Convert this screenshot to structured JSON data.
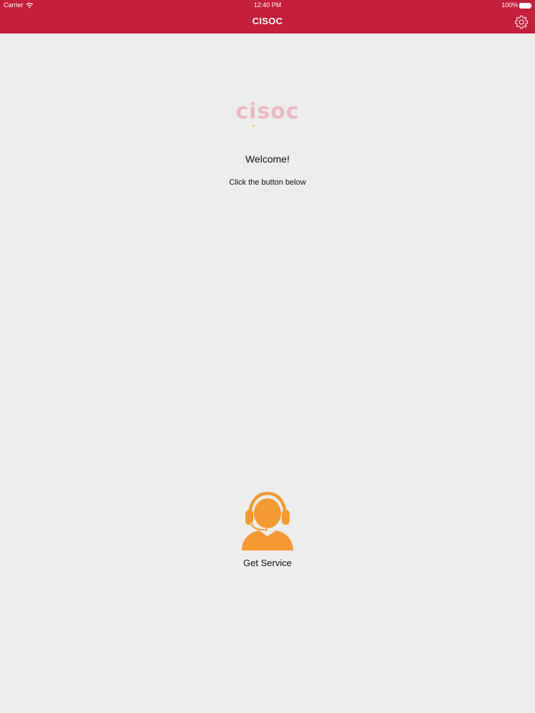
{
  "status_bar": {
    "carrier": "Carrier",
    "time": "12:40 PM",
    "battery": "100%"
  },
  "nav": {
    "title": "CISOC",
    "settings_icon": "gear-icon"
  },
  "main": {
    "logo": {
      "part1": "c",
      "part2": "i",
      "part3": "soc"
    },
    "welcome": "Welcome!",
    "hint": "Click the button below",
    "service_button": {
      "label": "Get Service",
      "icon": "headset-agent-icon"
    }
  },
  "colors": {
    "header": "#c41f3b",
    "background": "#ededed",
    "accent": "#f59a31",
    "logo": "#ecb8c1"
  }
}
